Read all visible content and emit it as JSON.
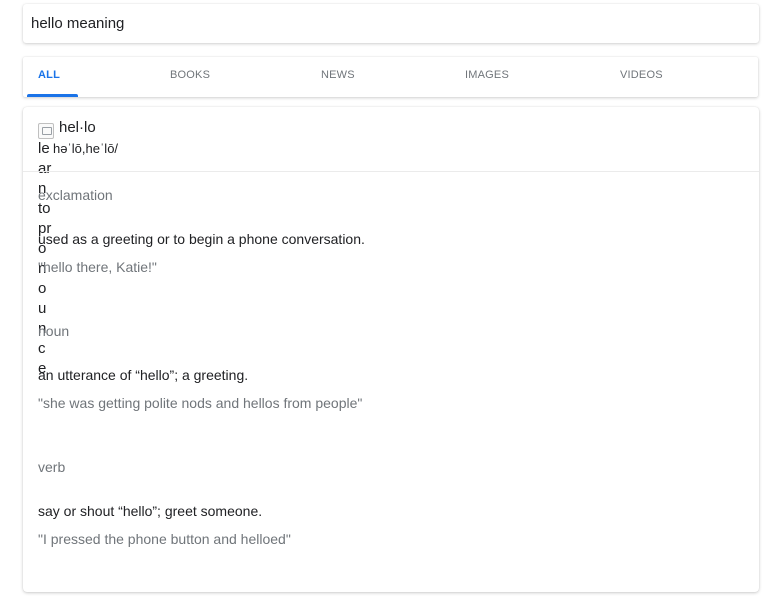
{
  "search": {
    "query": "hello meaning"
  },
  "tabs": [
    {
      "label": "ALL",
      "active": true
    },
    {
      "label": "BOOKS",
      "active": false
    },
    {
      "label": "NEWS",
      "active": false
    },
    {
      "label": "IMAGES",
      "active": false
    },
    {
      "label": "VIDEOS",
      "active": false
    }
  ],
  "dictionary": {
    "audio_alt": "learn to pronounce",
    "headword": "hel·lo",
    "phonetic": "həˈlō,heˈlō/",
    "entries": [
      {
        "pos": "exclamation",
        "definition": "used as a greeting or to begin a phone conversation.",
        "example": "\"hello there, Katie!\""
      },
      {
        "pos": "noun",
        "definition": "an utterance of “hello”; a greeting.",
        "example": "\"she was getting polite nods and hellos from people\""
      },
      {
        "pos": "verb",
        "definition": "say or shout “hello”; greet someone.",
        "example": "\"I pressed the phone button and helloed\""
      }
    ]
  },
  "colors": {
    "accent": "#1a73e8",
    "text": "#202124",
    "muted": "#70757a"
  }
}
